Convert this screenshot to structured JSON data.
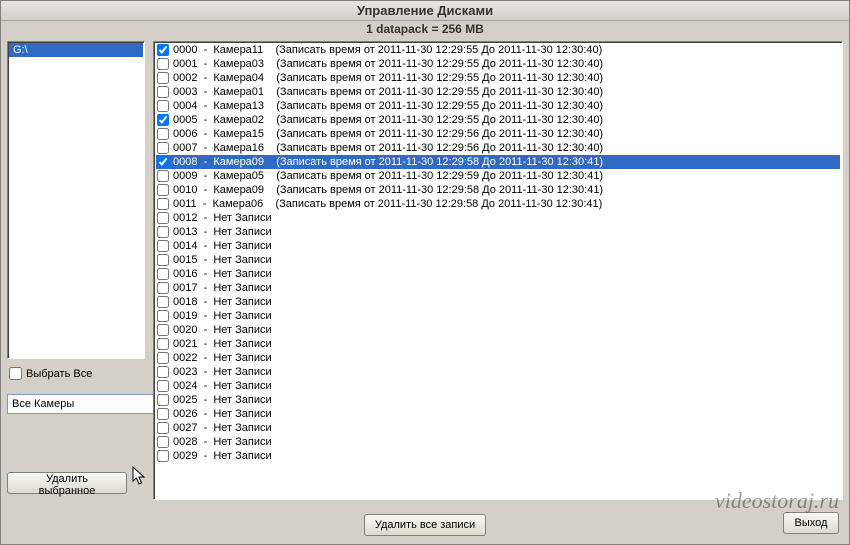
{
  "title": "Управление Дисками",
  "datapack_line": "1 datapack = 256 MB",
  "drive": "G:\\",
  "select_all_label": "Выбрать Все",
  "select_all_checked": false,
  "camera_filter": "Все Камеры",
  "btn_delete_selected": "Удалить выбранное",
  "btn_delete_all": "Удалить все записи",
  "btn_exit": "Выход",
  "watermark": "videostoraj.ru",
  "rows": [
    {
      "id": "0000",
      "camera": "Камера11",
      "checked": true,
      "selected": false,
      "has_time": true,
      "from": "2011-11-30 12:29:55",
      "to": "2011-11-30 12:30:40"
    },
    {
      "id": "0001",
      "camera": "Камера03",
      "checked": false,
      "selected": false,
      "has_time": true,
      "from": "2011-11-30 12:29:55",
      "to": "2011-11-30 12:30:40"
    },
    {
      "id": "0002",
      "camera": "Камера04",
      "checked": false,
      "selected": false,
      "has_time": true,
      "from": "2011-11-30 12:29:55",
      "to": "2011-11-30 12:30:40"
    },
    {
      "id": "0003",
      "camera": "Камера01",
      "checked": false,
      "selected": false,
      "has_time": true,
      "from": "2011-11-30 12:29:55",
      "to": "2011-11-30 12:30:40"
    },
    {
      "id": "0004",
      "camera": "Камера13",
      "checked": false,
      "selected": false,
      "has_time": true,
      "from": "2011-11-30 12:29:55",
      "to": "2011-11-30 12:30:40"
    },
    {
      "id": "0005",
      "camera": "Камера02",
      "checked": true,
      "selected": false,
      "has_time": true,
      "from": "2011-11-30 12:29:55",
      "to": "2011-11-30 12:30:40"
    },
    {
      "id": "0006",
      "camera": "Камера15",
      "checked": false,
      "selected": false,
      "has_time": true,
      "from": "2011-11-30 12:29:56",
      "to": "2011-11-30 12:30:40"
    },
    {
      "id": "0007",
      "camera": "Камера16",
      "checked": false,
      "selected": false,
      "has_time": true,
      "from": "2011-11-30 12:29:56",
      "to": "2011-11-30 12:30:40"
    },
    {
      "id": "0008",
      "camera": "Камера09",
      "checked": true,
      "selected": true,
      "has_time": true,
      "from": "2011-11-30 12:29:58",
      "to": "2011-11-30 12:30:41"
    },
    {
      "id": "0009",
      "camera": "Камера05",
      "checked": false,
      "selected": false,
      "has_time": true,
      "from": "2011-11-30 12:29:59",
      "to": "2011-11-30 12:30:41"
    },
    {
      "id": "0010",
      "camera": "Камера09",
      "checked": false,
      "selected": false,
      "has_time": true,
      "from": "2011-11-30 12:29:58",
      "to": "2011-11-30 12:30:41"
    },
    {
      "id": "0011",
      "camera": "Камера06",
      "checked": false,
      "selected": false,
      "has_time": true,
      "from": "2011-11-30 12:29:58",
      "to": "2011-11-30 12:30:41"
    },
    {
      "id": "0012",
      "camera": "",
      "checked": false,
      "selected": false,
      "has_time": false,
      "no_record": "Нет Записи"
    },
    {
      "id": "0013",
      "camera": "",
      "checked": false,
      "selected": false,
      "has_time": false,
      "no_record": "Нет Записи"
    },
    {
      "id": "0014",
      "camera": "",
      "checked": false,
      "selected": false,
      "has_time": false,
      "no_record": "Нет Записи"
    },
    {
      "id": "0015",
      "camera": "",
      "checked": false,
      "selected": false,
      "has_time": false,
      "no_record": "Нет Записи"
    },
    {
      "id": "0016",
      "camera": "",
      "checked": false,
      "selected": false,
      "has_time": false,
      "no_record": "Нет Записи"
    },
    {
      "id": "0017",
      "camera": "",
      "checked": false,
      "selected": false,
      "has_time": false,
      "no_record": "Нет Записи"
    },
    {
      "id": "0018",
      "camera": "",
      "checked": false,
      "selected": false,
      "has_time": false,
      "no_record": "Нет Записи"
    },
    {
      "id": "0019",
      "camera": "",
      "checked": false,
      "selected": false,
      "has_time": false,
      "no_record": "Нет Записи"
    },
    {
      "id": "0020",
      "camera": "",
      "checked": false,
      "selected": false,
      "has_time": false,
      "no_record": "Нет Записи"
    },
    {
      "id": "0021",
      "camera": "",
      "checked": false,
      "selected": false,
      "has_time": false,
      "no_record": "Нет Записи"
    },
    {
      "id": "0022",
      "camera": "",
      "checked": false,
      "selected": false,
      "has_time": false,
      "no_record": "Нет Записи"
    },
    {
      "id": "0023",
      "camera": "",
      "checked": false,
      "selected": false,
      "has_time": false,
      "no_record": "Нет Записи"
    },
    {
      "id": "0024",
      "camera": "",
      "checked": false,
      "selected": false,
      "has_time": false,
      "no_record": "Нет Записи"
    },
    {
      "id": "0025",
      "camera": "",
      "checked": false,
      "selected": false,
      "has_time": false,
      "no_record": "Нет Записи"
    },
    {
      "id": "0026",
      "camera": "",
      "checked": false,
      "selected": false,
      "has_time": false,
      "no_record": "Нет Записи"
    },
    {
      "id": "0027",
      "camera": "",
      "checked": false,
      "selected": false,
      "has_time": false,
      "no_record": "Нет Записи"
    },
    {
      "id": "0028",
      "camera": "",
      "checked": false,
      "selected": false,
      "has_time": false,
      "no_record": "Нет Записи"
    },
    {
      "id": "0029",
      "camera": "",
      "checked": false,
      "selected": false,
      "has_time": false,
      "no_record": "Нет Записи"
    }
  ],
  "row_label_prefix": "Записать время от",
  "row_label_mid": "До"
}
